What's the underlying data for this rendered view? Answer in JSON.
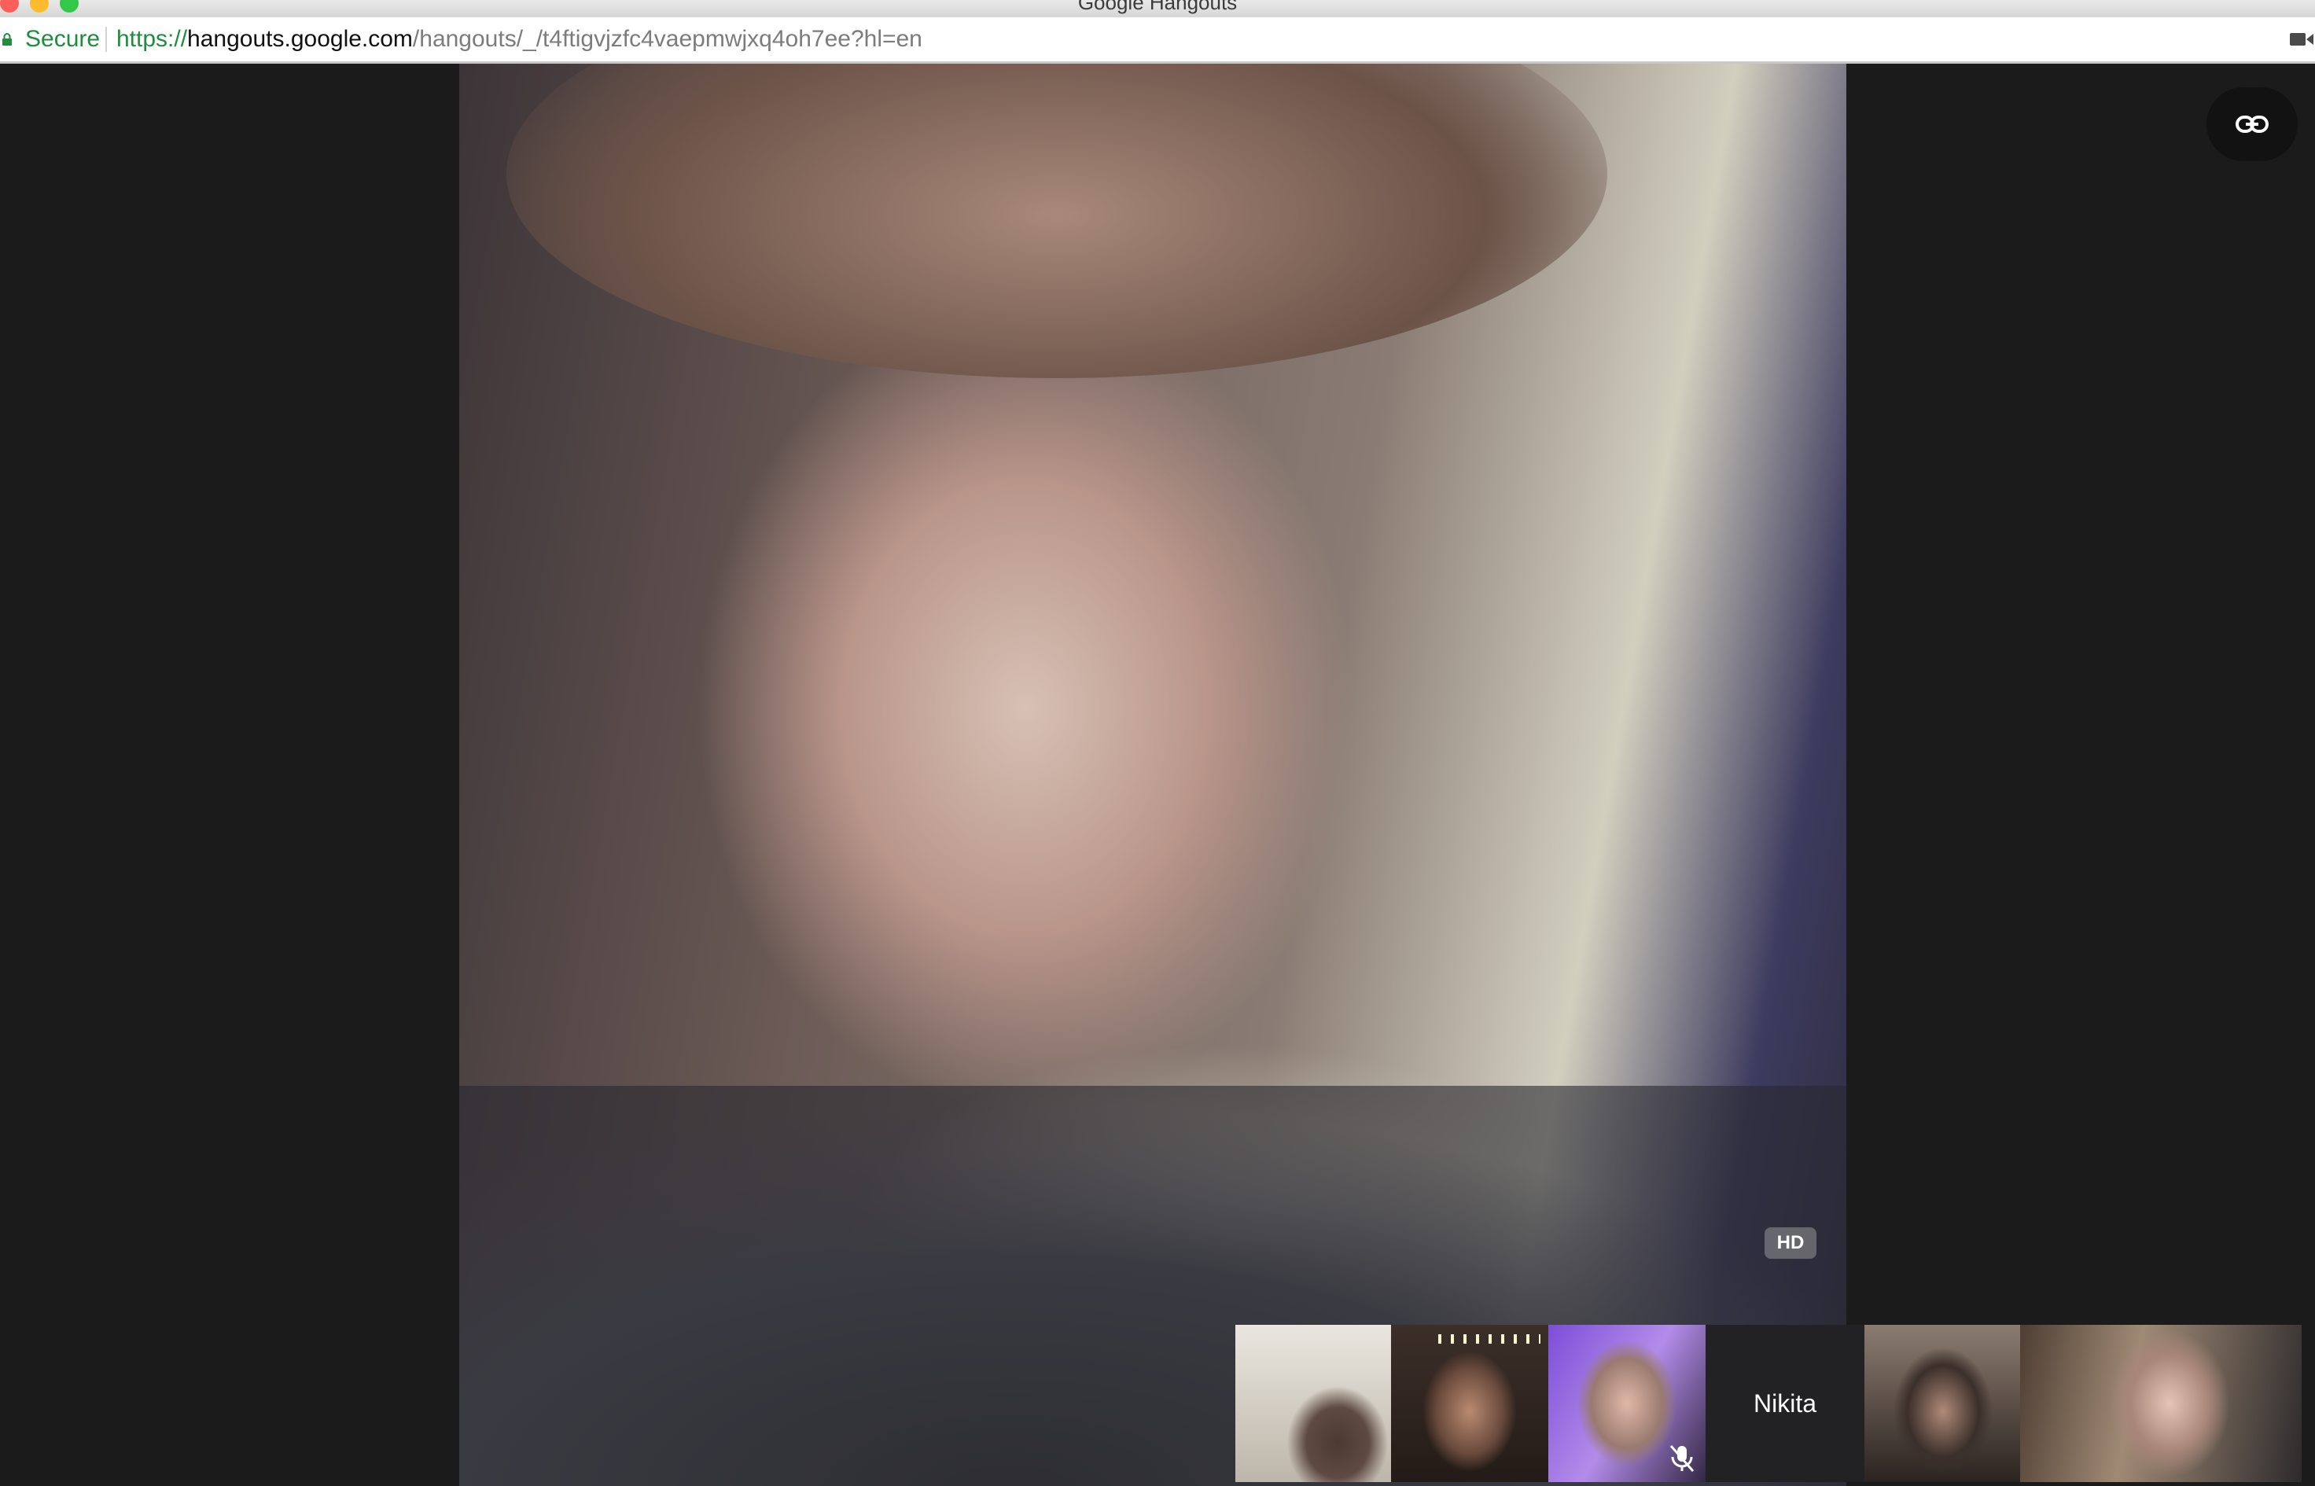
{
  "window": {
    "title": "Google Hangouts"
  },
  "addressbar": {
    "secure_label": "Secure",
    "url_scheme": "https://",
    "url_host": "hangouts.google.com",
    "url_path": "/hangouts/_/t4ftigvjzfc4vaepmwjxq4oh7ee?hl=en",
    "icons": [
      "lock-icon",
      "video-camera-icon"
    ]
  },
  "main_video": {
    "quality_badge": "HD"
  },
  "controls": {
    "copy_link_icon": "link-icon"
  },
  "participants": [
    {
      "type": "video"
    },
    {
      "type": "video"
    },
    {
      "type": "video",
      "muted": true,
      "icon": "mic-off-icon"
    },
    {
      "type": "name",
      "name": "Nikita"
    },
    {
      "type": "video"
    },
    {
      "type": "video"
    }
  ],
  "colors": {
    "secure_green": "#1e8e3e",
    "background": "#1b1b1b",
    "badge_bg": "#969696"
  }
}
